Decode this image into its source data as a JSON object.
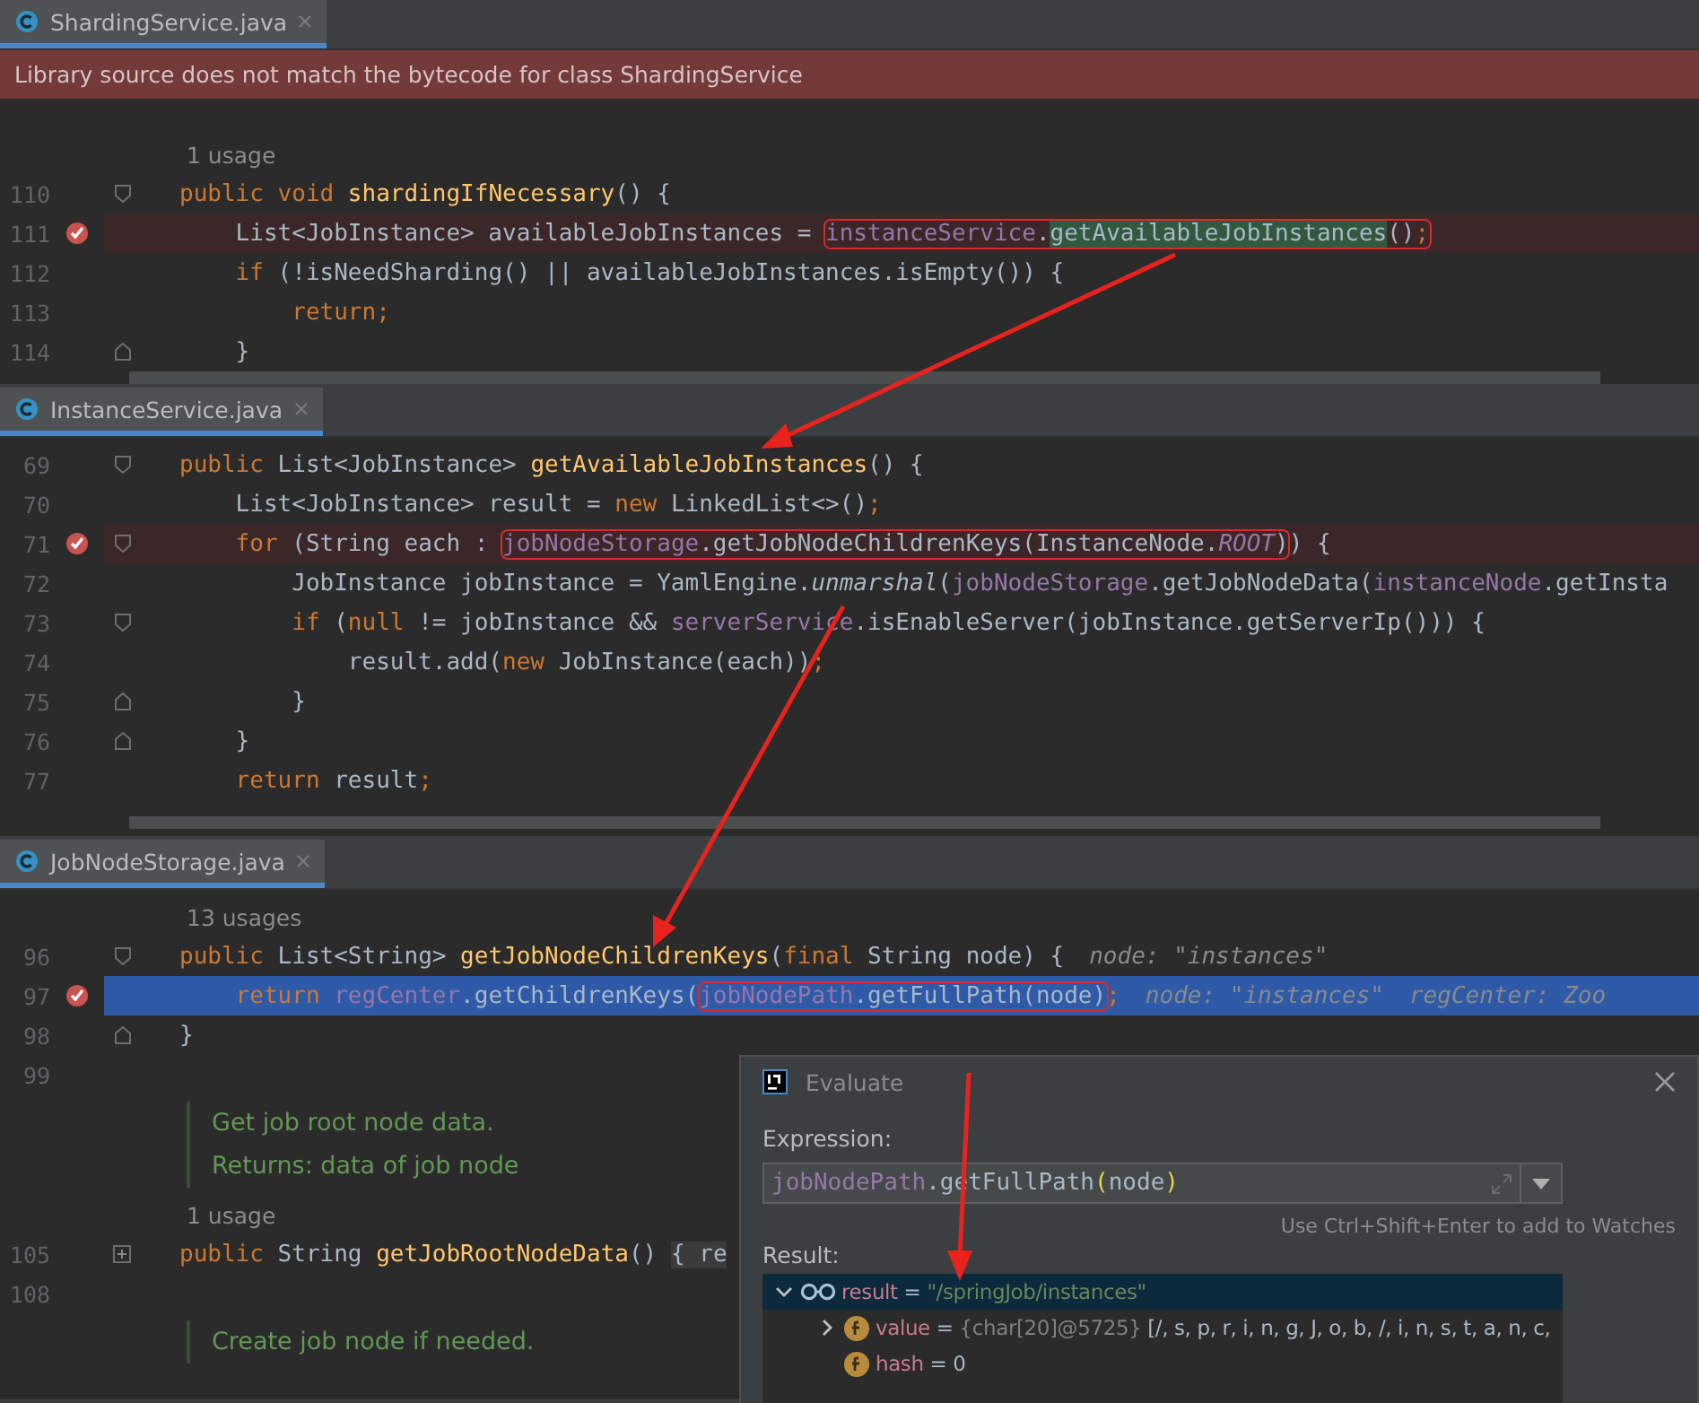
{
  "panes": [
    {
      "tab": {
        "title": "ShardingService.java"
      },
      "banner": "Library source does not match the bytecode for class ShardingService",
      "lines": [
        {
          "kind": "usage",
          "text": "1 usage"
        },
        {
          "kind": "code",
          "number": "110",
          "fold_start": true,
          "parts": [
            {
              "kind": "code",
              "tokens": [
                {
                  "kind": "kw",
                  "text": "public void "
                },
                {
                  "kind": "decl",
                  "text": "shardingIfNecessary"
                },
                {
                  "kind": "plain",
                  "text": "() {"
                }
              ]
            }
          ]
        },
        {
          "kind": "code",
          "number": "111",
          "breakpoint": true,
          "parts": [
            {
              "kind": "code",
              "tokens": [
                {
                  "kind": "plain",
                  "text": "    List<JobInstance> availableJobInstances = "
                }
              ]
            },
            {
              "kind": "box",
              "tokens": [
                {
                  "kind": "field",
                  "text": "instanceService"
                },
                {
                  "kind": "plain",
                  "text": "."
                },
                {
                  "kind": "match",
                  "text": "getAvailableJobInstances"
                },
                {
                  "kind": "plain",
                  "text": "()"
                },
                {
                  "kind": "kw",
                  "text": ";"
                }
              ]
            }
          ]
        },
        {
          "kind": "code",
          "number": "112",
          "parts": [
            {
              "kind": "code",
              "tokens": [
                {
                  "kind": "kw",
                  "text": "    if "
                },
                {
                  "kind": "plain",
                  "text": "(!isNeedSharding() || availableJobInstances.isEmpty()) {"
                }
              ]
            }
          ]
        },
        {
          "kind": "code",
          "number": "113",
          "parts": [
            {
              "kind": "code",
              "tokens": [
                {
                  "kind": "kw",
                  "text": "        return;"
                }
              ]
            }
          ]
        },
        {
          "kind": "code",
          "number": "114",
          "fold_end": true,
          "parts": [
            {
              "kind": "code",
              "tokens": [
                {
                  "kind": "plain",
                  "text": "    }"
                }
              ]
            }
          ]
        }
      ]
    },
    {
      "tab": {
        "title": "InstanceService.java"
      },
      "lines": [
        {
          "kind": "code",
          "number": "69",
          "fold_start": true,
          "parts": [
            {
              "kind": "code",
              "tokens": [
                {
                  "kind": "kw",
                  "text": "public "
                },
                {
                  "kind": "plain",
                  "text": "List<JobInstance> "
                },
                {
                  "kind": "decl",
                  "text": "getAvailableJobInstances"
                },
                {
                  "kind": "plain",
                  "text": "() {"
                }
              ]
            }
          ]
        },
        {
          "kind": "code",
          "number": "70",
          "parts": [
            {
              "kind": "code",
              "tokens": [
                {
                  "kind": "plain",
                  "text": "    List<JobInstance> result = "
                },
                {
                  "kind": "kw",
                  "text": "new "
                },
                {
                  "kind": "plain",
                  "text": "LinkedList<>()"
                },
                {
                  "kind": "kw",
                  "text": ";"
                }
              ]
            }
          ]
        },
        {
          "kind": "code",
          "number": "71",
          "breakpoint": true,
          "fold_start": true,
          "parts": [
            {
              "kind": "code",
              "tokens": [
                {
                  "kind": "kw",
                  "text": "    for "
                },
                {
                  "kind": "plain",
                  "text": "(String each : "
                }
              ]
            },
            {
              "kind": "box",
              "tokens": [
                {
                  "kind": "field",
                  "text": "jobNodeStorage"
                },
                {
                  "kind": "plain",
                  "text": ".getJobNodeChildrenKeys(InstanceNode."
                },
                {
                  "kind": "static",
                  "text": "ROOT"
                },
                {
                  "kind": "plain",
                  "text": ")"
                }
              ]
            },
            {
              "kind": "code",
              "tokens": [
                {
                  "kind": "plain",
                  "text": ") {"
                }
              ]
            }
          ]
        },
        {
          "kind": "code",
          "number": "72",
          "parts": [
            {
              "kind": "code",
              "tokens": [
                {
                  "kind": "plain",
                  "text": "        JobInstance jobInstance = YamlEngine."
                },
                {
                  "kind": "italic",
                  "text": "unmarshal"
                },
                {
                  "kind": "plain",
                  "text": "("
                },
                {
                  "kind": "field",
                  "text": "jobNodeStorage"
                },
                {
                  "kind": "plain",
                  "text": ".getJobNodeData("
                },
                {
                  "kind": "field",
                  "text": "instanceNode"
                },
                {
                  "kind": "plain",
                  "text": ".getInsta"
                }
              ]
            }
          ]
        },
        {
          "kind": "code",
          "number": "73",
          "fold_start": true,
          "parts": [
            {
              "kind": "code",
              "tokens": [
                {
                  "kind": "kw",
                  "text": "        if "
                },
                {
                  "kind": "plain",
                  "text": "("
                },
                {
                  "kind": "kw",
                  "text": "null "
                },
                {
                  "kind": "plain",
                  "text": "!= jobInstance && "
                },
                {
                  "kind": "field",
                  "text": "serverService"
                },
                {
                  "kind": "plain",
                  "text": ".isEnableServer(jobInstance.getServerIp())) {"
                }
              ]
            }
          ]
        },
        {
          "kind": "code",
          "number": "74",
          "parts": [
            {
              "kind": "code",
              "tokens": [
                {
                  "kind": "plain",
                  "text": "            result.add("
                },
                {
                  "kind": "kw",
                  "text": "new "
                },
                {
                  "kind": "plain",
                  "text": "JobInstance(each))"
                },
                {
                  "kind": "kw",
                  "text": ";"
                }
              ]
            }
          ]
        },
        {
          "kind": "code",
          "number": "75",
          "fold_end": true,
          "parts": [
            {
              "kind": "code",
              "tokens": [
                {
                  "kind": "plain",
                  "text": "        }"
                }
              ]
            }
          ]
        },
        {
          "kind": "code",
          "number": "76",
          "fold_end": true,
          "parts": [
            {
              "kind": "code",
              "tokens": [
                {
                  "kind": "plain",
                  "text": "    }"
                }
              ]
            }
          ]
        },
        {
          "kind": "code",
          "number": "77",
          "parts": [
            {
              "kind": "code",
              "tokens": [
                {
                  "kind": "kw",
                  "text": "    return "
                },
                {
                  "kind": "plain",
                  "text": "result"
                },
                {
                  "kind": "kw",
                  "text": ";"
                }
              ]
            }
          ]
        }
      ]
    },
    {
      "tab": {
        "title": "JobNodeStorage.java"
      },
      "lines": [
        {
          "kind": "usage",
          "text": "13 usages"
        },
        {
          "kind": "code",
          "number": "96",
          "fold_start": true,
          "parts": [
            {
              "kind": "code",
              "tokens": [
                {
                  "kind": "kw",
                  "text": "public "
                },
                {
                  "kind": "plain",
                  "text": "List<String> "
                },
                {
                  "kind": "decl",
                  "text": "getJobNodeChildrenKeys"
                },
                {
                  "kind": "plain",
                  "text": "("
                },
                {
                  "kind": "kw",
                  "text": "final "
                },
                {
                  "kind": "plain",
                  "text": "String node) {"
                }
              ]
            },
            {
              "kind": "hint",
              "text": "node: \"instances\""
            }
          ]
        },
        {
          "kind": "code",
          "number": "97",
          "breakpoint": true,
          "current": true,
          "parts": [
            {
              "kind": "code",
              "tokens": [
                {
                  "kind": "kw",
                  "text": "    return "
                },
                {
                  "kind": "field",
                  "text": "regCenter"
                },
                {
                  "kind": "plain",
                  "text": ".getChildrenKeys("
                }
              ]
            },
            {
              "kind": "box",
              "tokens": [
                {
                  "kind": "field",
                  "text": "jobNodePath"
                },
                {
                  "kind": "plain",
                  "text": ".getFullPath(node)"
                }
              ]
            },
            {
              "kind": "code",
              "tokens": [
                {
                  "kind": "kw",
                  "text": ";"
                }
              ]
            },
            {
              "kind": "hint",
              "text": "node: \"instances\""
            },
            {
              "kind": "hint",
              "text": "regCenter: Zoo"
            }
          ]
        },
        {
          "kind": "code",
          "number": "98",
          "fold_end": true,
          "parts": [
            {
              "kind": "code",
              "tokens": [
                {
                  "kind": "plain",
                  "text": "}"
                }
              ]
            }
          ]
        },
        {
          "kind": "code",
          "number": "99"
        },
        {
          "kind": "doc",
          "texts": [
            "Get job root node data.",
            "Returns: data of job node"
          ]
        },
        {
          "kind": "usage",
          "text": "1 usage"
        },
        {
          "kind": "code",
          "number": "105",
          "collapsed": true,
          "parts": [
            {
              "kind": "code",
              "tokens": [
                {
                  "kind": "kw",
                  "text": "public "
                },
                {
                  "kind": "plain",
                  "text": "String "
                },
                {
                  "kind": "decl",
                  "text": "getJobRootNodeData"
                },
                {
                  "kind": "plain",
                  "text": "() "
                },
                {
                  "kind": "folded",
                  "text": "{ re"
                }
              ]
            }
          ]
        },
        {
          "kind": "code",
          "number": "108"
        },
        {
          "kind": "doc",
          "texts": [
            "Create job node if needed."
          ]
        }
      ]
    }
  ],
  "evaluate_dialog": {
    "title": "Evaluate",
    "expression_label": "Expression:",
    "expression": [
      {
        "kind": "field",
        "text": "jobNodePath"
      },
      {
        "kind": "plain",
        "text": ".getFullPath"
      },
      {
        "kind": "paren",
        "text": "("
      },
      {
        "kind": "plain",
        "text": "node"
      },
      {
        "kind": "paren",
        "text": ")"
      }
    ],
    "hint": "Use Ctrl+Shift+Enter to add to Watches",
    "result_label": "Result:",
    "result_tree": [
      {
        "kind": "watch",
        "selected": true,
        "expanded": true,
        "tokens": [
          {
            "kind": "name",
            "text": "result"
          },
          {
            "kind": "plain",
            "text": " = "
          },
          {
            "kind": "str",
            "text": "\"/springJob/instances\""
          }
        ],
        "children": [
          {
            "kind": "field",
            "selected": false,
            "expanded": false,
            "tokens": [
              {
                "kind": "name",
                "text": "value"
              },
              {
                "kind": "plain",
                "text": " = "
              },
              {
                "kind": "type",
                "text": "{char[20]@5725} "
              },
              {
                "kind": "plain",
                "text": "[/, s, p, r, i, n, g, J, o, b, /, i, n, s, t, a, n, c,"
              }
            ]
          },
          {
            "kind": "field",
            "selected": false,
            "tokens": [
              {
                "kind": "name",
                "text": "hash"
              },
              {
                "kind": "plain",
                "text": " = 0"
              }
            ]
          }
        ]
      }
    ]
  }
}
